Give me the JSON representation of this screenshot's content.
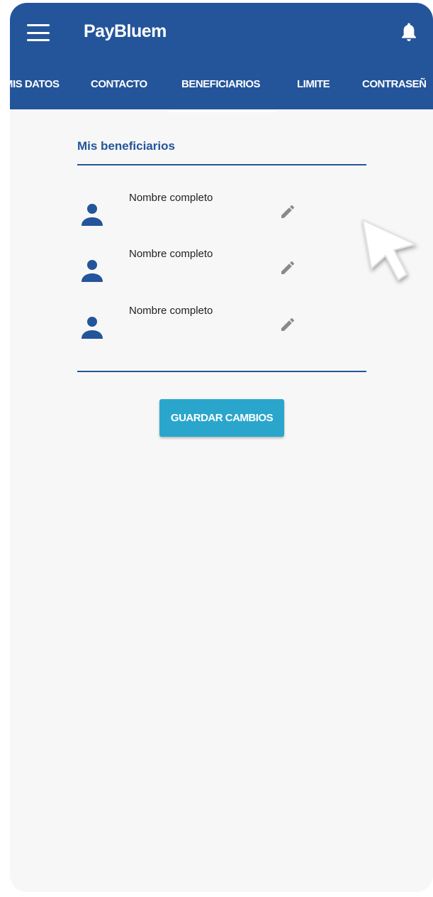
{
  "app": {
    "title": "PayBluem"
  },
  "icons": {
    "menu": "menu-icon",
    "bell": "bell-icon",
    "avatar": "person-icon",
    "edit": "pencil-icon",
    "cursor": "pointer-cursor"
  },
  "colors": {
    "primary": "#24559a",
    "accent": "#2aa6cc",
    "background": "#f7f7f7"
  },
  "tabs": [
    {
      "label": "MIS DATOS"
    },
    {
      "label": "CONTACTO"
    },
    {
      "label": "BENEFICIARIOS",
      "active": true
    },
    {
      "label": "LIMITE"
    },
    {
      "label": "CONTRASEÑ"
    }
  ],
  "beneficiaries": {
    "title": "Mis beneficiarios",
    "items": [
      {
        "name": "Nombre completo"
      },
      {
        "name": "Nombre completo"
      },
      {
        "name": "Nombre completo"
      }
    ]
  },
  "actions": {
    "save_label": "GUARDAR CAMBIOS"
  }
}
